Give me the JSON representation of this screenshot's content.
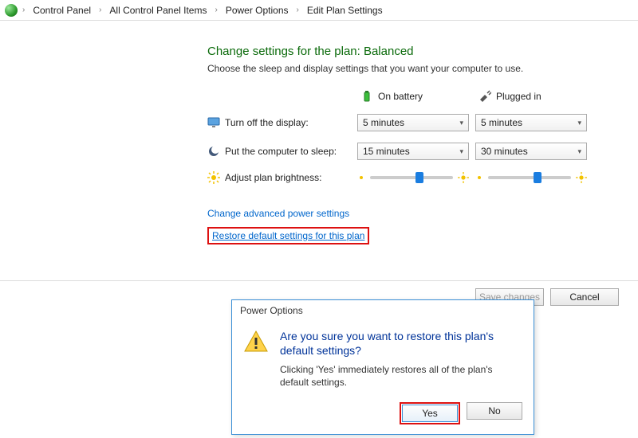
{
  "breadcrumb": {
    "items": [
      "Control Panel",
      "All Control Panel Items",
      "Power Options",
      "Edit Plan Settings"
    ]
  },
  "heading": "Change settings for the plan: Balanced",
  "subtext": "Choose the sleep and display settings that you want your computer to use.",
  "columns": {
    "battery": "On battery",
    "plugged": "Plugged in"
  },
  "rows": {
    "display": {
      "label": "Turn off the display:",
      "battery": "5 minutes",
      "plugged": "5 minutes"
    },
    "sleep": {
      "label": "Put the computer to sleep:",
      "battery": "15 minutes",
      "plugged": "30 minutes"
    },
    "brightness": {
      "label": "Adjust plan brightness:",
      "battery_pct": 55,
      "plugged_pct": 55
    }
  },
  "links": {
    "advanced": "Change advanced power settings",
    "restore": "Restore default settings for this plan"
  },
  "footer": {
    "save": "Save changes",
    "cancel": "Cancel"
  },
  "dialog": {
    "title": "Power Options",
    "heading": "Are you sure you want to restore this plan's default settings?",
    "body": "Clicking 'Yes' immediately restores all of the plan's default settings.",
    "yes": "Yes",
    "no": "No"
  }
}
